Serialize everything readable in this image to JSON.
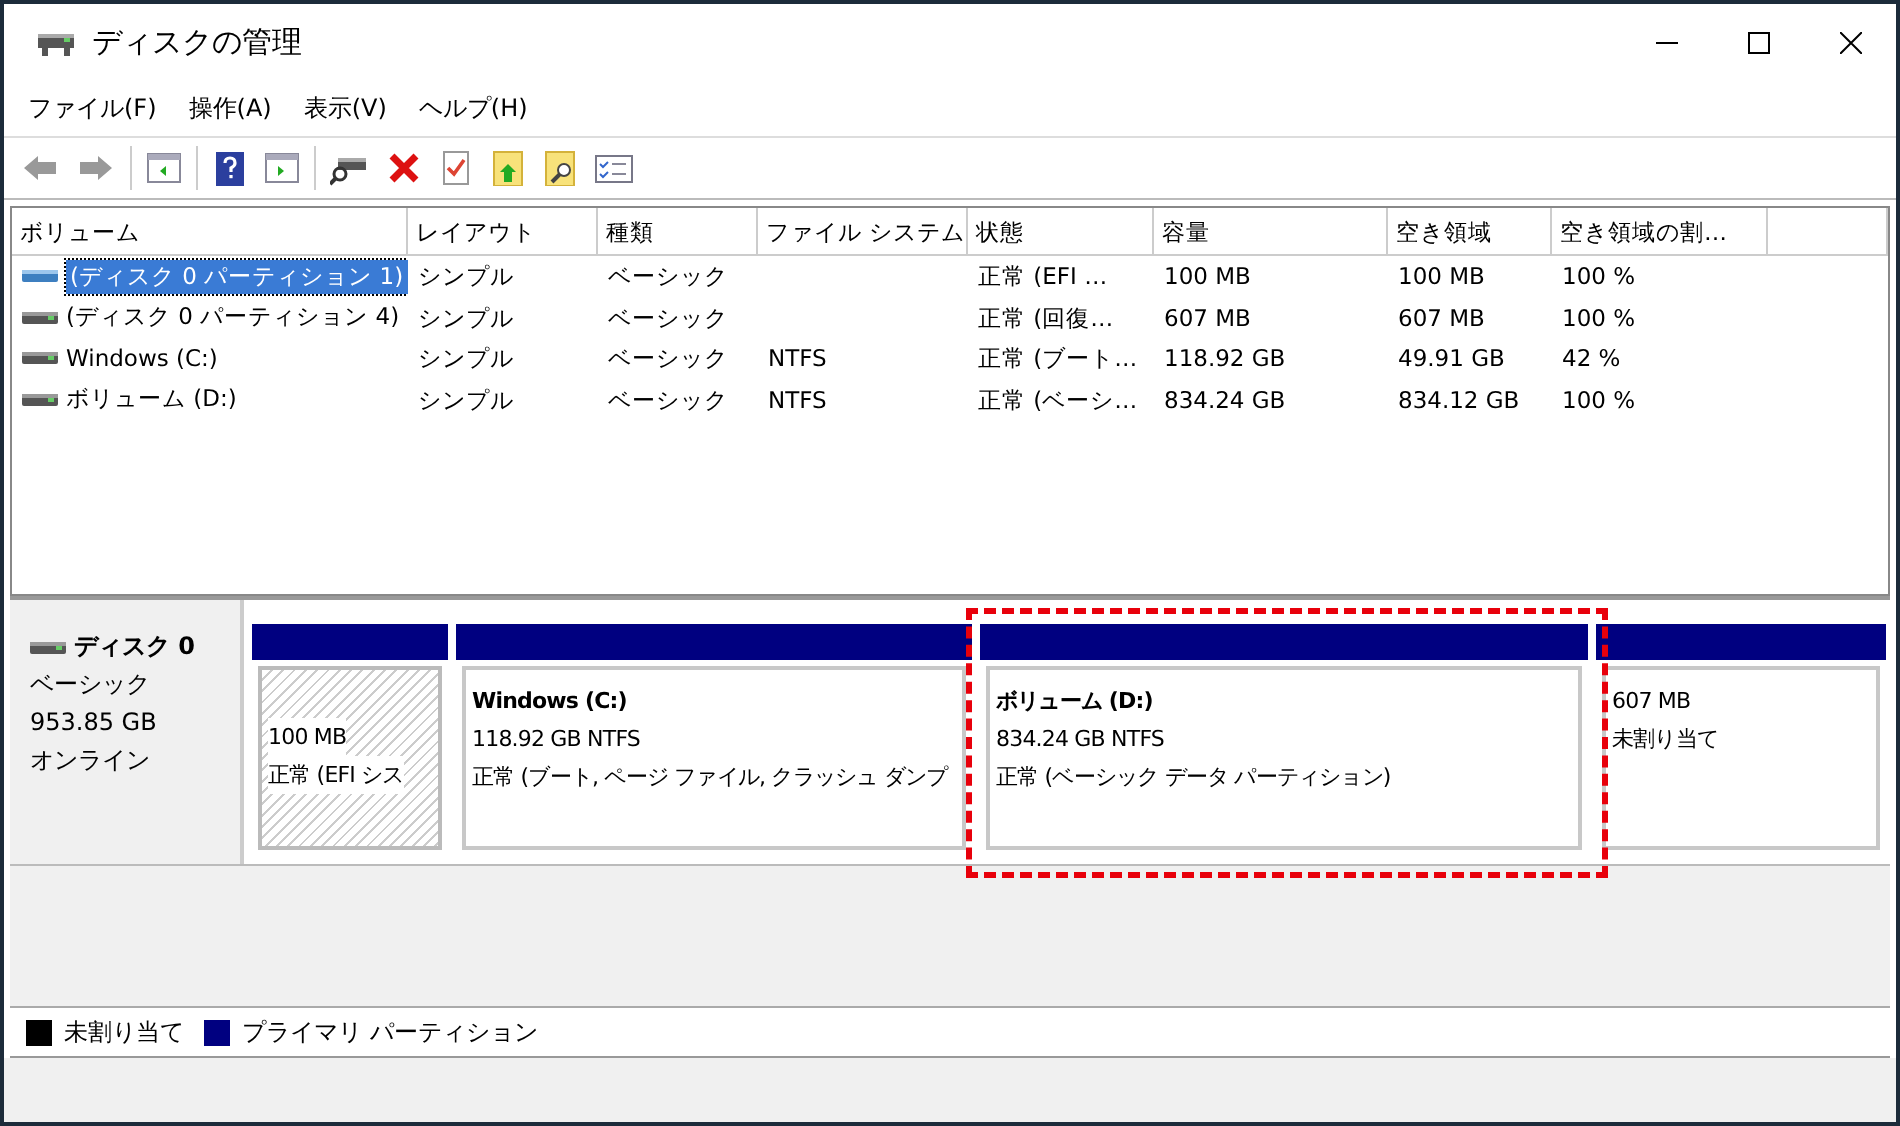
{
  "window": {
    "title": "ディスクの管理"
  },
  "menu": [
    "ファイル(F)",
    "操作(A)",
    "表示(V)",
    "ヘルプ(H)"
  ],
  "volumes": {
    "columns": [
      "ボリューム",
      "レイアウト",
      "種類",
      "ファイル システム",
      "状態",
      "容量",
      "空き領域",
      "空き領域の割…"
    ],
    "rows": [
      {
        "selected": true,
        "cells": [
          "(ディスク 0 パーティション 1)",
          "シンプル",
          "ベーシック",
          "",
          "正常 (EFI …",
          "100 MB",
          "100 MB",
          "100 %"
        ]
      },
      {
        "selected": false,
        "cells": [
          "(ディスク 0 パーティション 4)",
          "シンプル",
          "ベーシック",
          "",
          "正常 (回復…",
          "607 MB",
          "607 MB",
          "100 %"
        ]
      },
      {
        "selected": false,
        "cells": [
          "Windows (C:)",
          "シンプル",
          "ベーシック",
          "NTFS",
          "正常 (ブート…",
          "118.92 GB",
          "49.91 GB",
          "42 %"
        ]
      },
      {
        "selected": false,
        "cells": [
          "ボリューム (D:)",
          "シンプル",
          "ベーシック",
          "NTFS",
          "正常 (ベーシ…",
          "834.24 GB",
          "834.12 GB",
          "100 %"
        ]
      }
    ]
  },
  "disks": [
    {
      "name": "ディスク 0",
      "type": "ベーシック",
      "size": "953.85 GB",
      "status": "オンライン",
      "partitions": [
        {
          "kind": "hatched",
          "size": "100 MB",
          "status": "正常 (EFI シス"
        },
        {
          "kind": "plain",
          "title": "Windows (C:)",
          "size": "118.92 GB NTFS",
          "status": "正常 (ブート, ページ ファイル, クラッシュ ダンプ"
        },
        {
          "kind": "plain",
          "title": "ボリューム (D:)",
          "size": "834.24 GB NTFS",
          "status": "正常 (ベーシック データ パーティション)"
        },
        {
          "kind": "plain",
          "size": "607 MB",
          "status": "未割り当て"
        }
      ]
    }
  ],
  "legend": [
    {
      "label": "未割り当て",
      "color": "#000000"
    },
    {
      "label": "プライマリ パーティション",
      "color": "#000080"
    }
  ]
}
